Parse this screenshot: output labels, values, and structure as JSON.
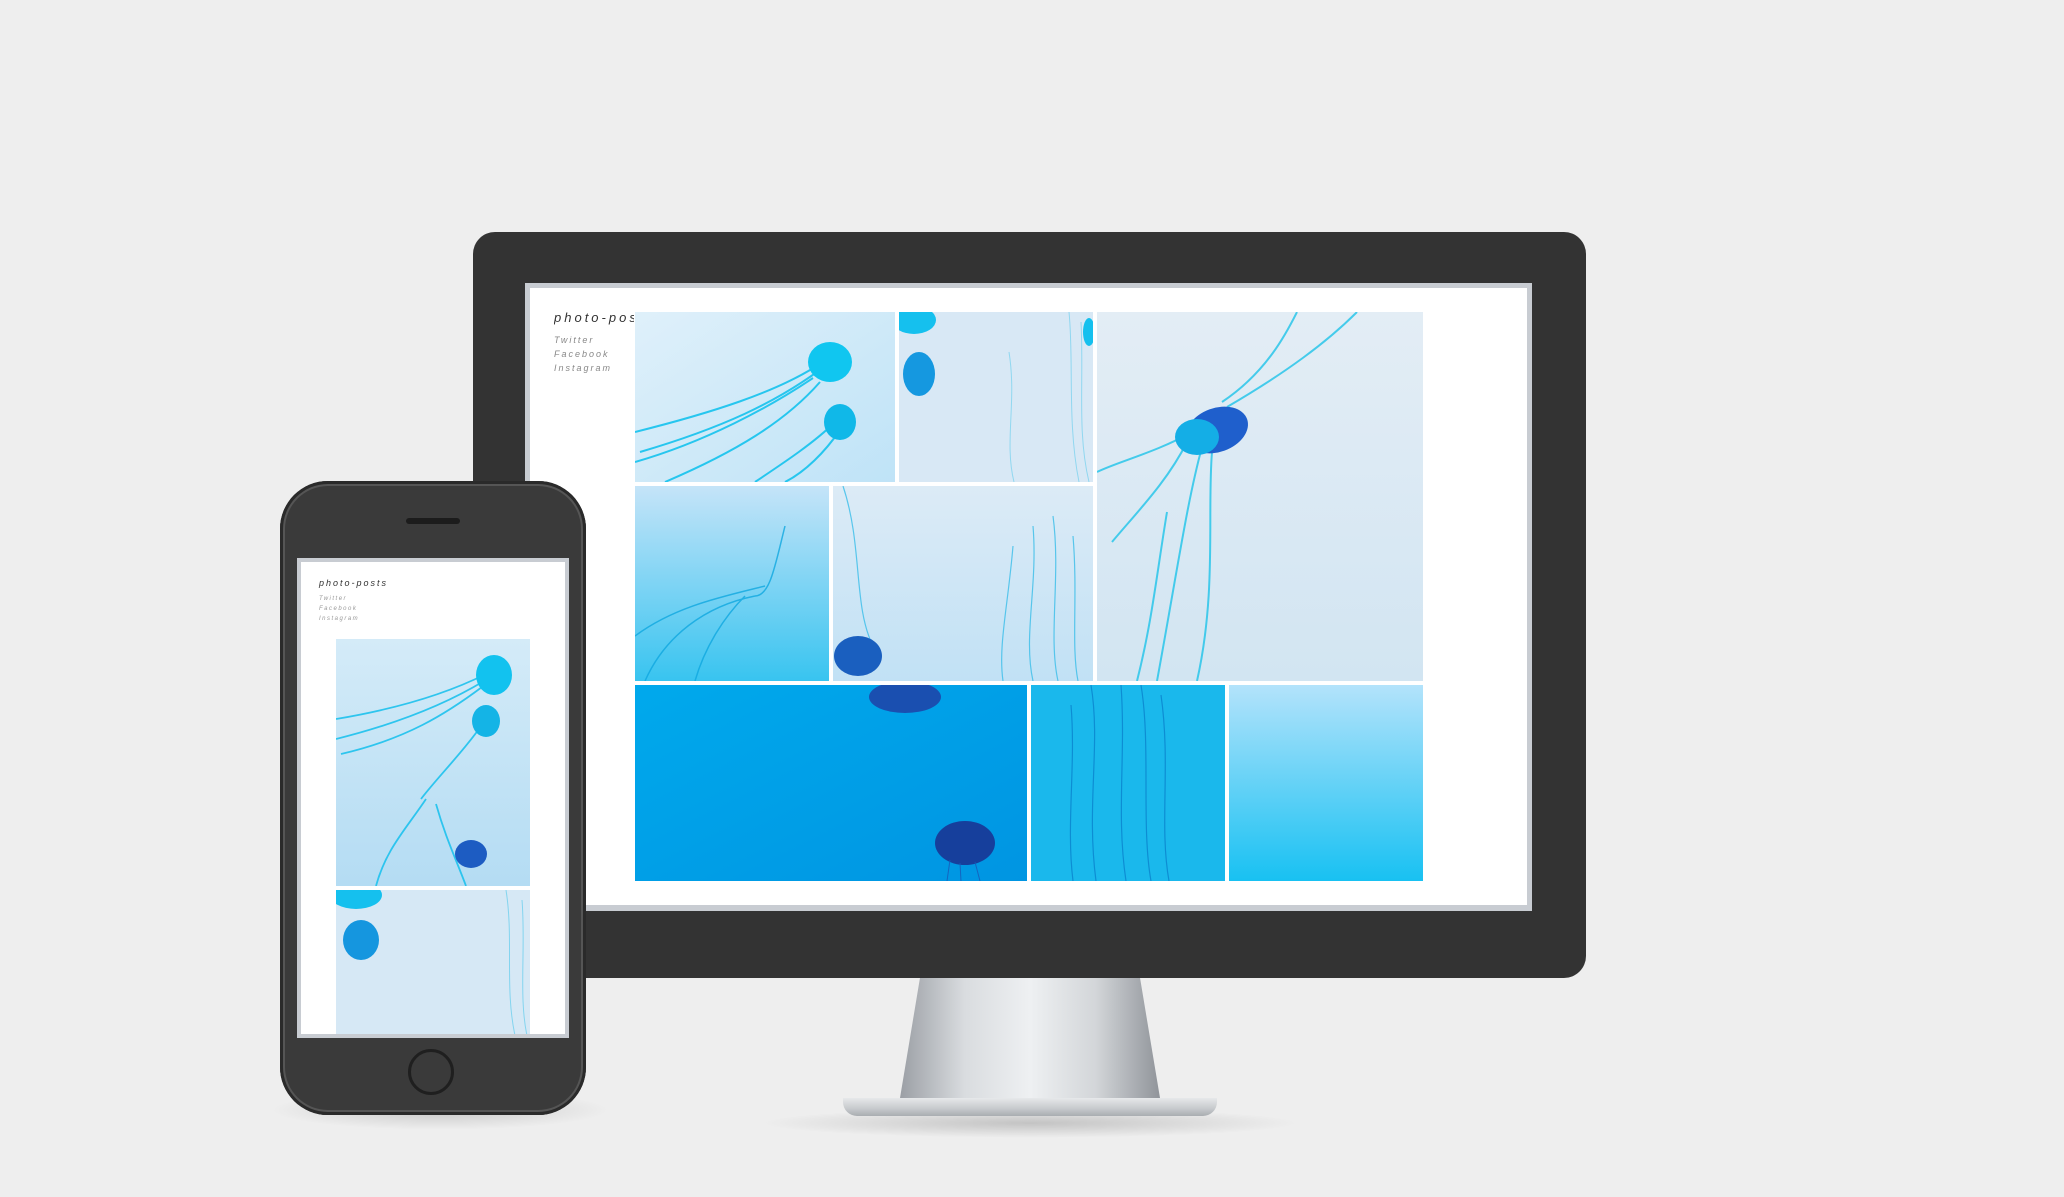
{
  "site": {
    "title": "photo-posts",
    "links": [
      "Twitter",
      "Facebook",
      "Instagram"
    ]
  },
  "colors": {
    "background": "#eeeeee",
    "device_frame": "#333333",
    "page": "#ffffff",
    "accent_cyan": "#00b4ea",
    "accent_blue": "#1560c8"
  },
  "icons": {
    "phone_home": "home-button-icon",
    "phone_speaker": "speaker-icon"
  }
}
